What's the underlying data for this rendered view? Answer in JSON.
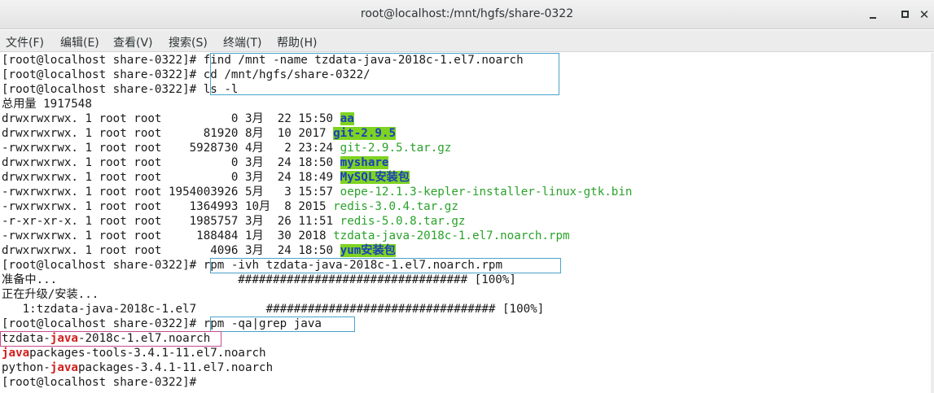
{
  "window": {
    "title": "root@localhost:/mnt/hgfs/share-0322",
    "close_glyph": "✕"
  },
  "menu": [
    "文件(F)",
    "编辑(E)",
    "查看(V)",
    "搜索(S)",
    "终端(T)",
    "帮助(H)"
  ],
  "terminal": {
    "prompt": "[root@localhost share-0322]# ",
    "cmd1": "find /mnt -name tzdata-java-2018c-1.el7.noarch",
    "cmd2": "cd /mnt/hgfs/share-0322/",
    "cmd3": "ls -l",
    "total": "总用量 1917548",
    "listing": [
      {
        "meta": "drwxrwxrwx. 1 root root          0 3月  22 15:50 ",
        "name": "aa",
        "kind": "dir"
      },
      {
        "meta": "drwxrwxrwx. 1 root root      81920 8月  10 2017 ",
        "name": "git-2.9.5",
        "kind": "dir"
      },
      {
        "meta": "-rwxrwxrwx. 1 root root    5928730 4月   2 23:24 ",
        "name": "git-2.9.5.tar.gz",
        "kind": "arc"
      },
      {
        "meta": "drwxrwxrwx. 1 root root          0 3月  24 18:50 ",
        "name": "myshare",
        "kind": "dir"
      },
      {
        "meta": "drwxrwxrwx. 1 root root          0 3月  24 18:49 ",
        "name": "MySQL安装包",
        "kind": "dir"
      },
      {
        "meta": "-rwxrwxrwx. 1 root root 1954003926 5月   3 15:57 ",
        "name": "oepe-12.1.3-kepler-installer-linux-gtk.bin",
        "kind": "arc"
      },
      {
        "meta": "-rwxrwxrwx. 1 root root    1364993 10月  8 2015 ",
        "name": "redis-3.0.4.tar.gz",
        "kind": "arc"
      },
      {
        "meta": "-r-xr-xr-x. 1 root root    1985757 3月  26 11:51 ",
        "name": "redis-5.0.8.tar.gz",
        "kind": "arc"
      },
      {
        "meta": "-rwxrwxrwx. 1 root root     188484 1月  30 2018 ",
        "name": "tzdata-java-2018c-1.el7.noarch.rpm",
        "kind": "rpm"
      },
      {
        "meta": "drwxrwxrwx. 1 root root       4096 3月  24 18:50 ",
        "name": "yum安装包",
        "kind": "dir"
      }
    ],
    "cmd4": "rpm -ivh tzdata-java-2018c-1.el7.noarch.rpm",
    "prep": "准备中...                          ################################# [100%]",
    "upgrading": "正在升级/安装...",
    "pkgline": "   1:tzdata-java-2018c-1.el7          ################################# [100%]",
    "cmd5": "rpm -qa|grep java",
    "results": [
      {
        "pre": "tzdata-",
        "hl": "java",
        "post": "-2018c-1.el7.noarch"
      },
      {
        "pre": "",
        "hl": "java",
        "post": "packages-tools-3.4.1-11.el7.noarch"
      },
      {
        "pre": "python-",
        "hl": "java",
        "post": "packages-3.4.1-11.el7.noarch"
      }
    ]
  },
  "colors": {
    "dir_bg": "#7ed321",
    "dir_fg": "#1a3fbf",
    "archive_fg": "#2aa22a",
    "grep_hl": "#d21f1f",
    "box_outline": "#4aa3c9",
    "box_outline_pink": "#c84a8f"
  }
}
